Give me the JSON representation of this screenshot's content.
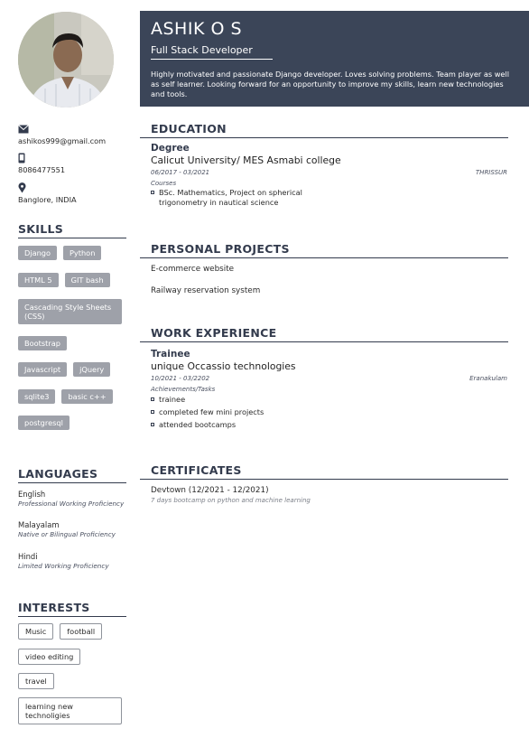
{
  "header": {
    "name": "ASHIK O S",
    "role": "Full Stack Developer",
    "summary": "Highly motivated and passionate Django developer. Loves solving problems. Team player as well as self learner. Looking forward for an opportunity to improve my skills, learn new technologies and tools."
  },
  "contact": {
    "email": "ashikos999@gmail.com",
    "phone": "8086477551",
    "location": "Banglore, INDIA",
    "icons": [
      "envelope-icon",
      "phone-icon",
      "location-pin-icon"
    ]
  },
  "skills": {
    "title": "SKILLS",
    "items": [
      "Django",
      "Python",
      "HTML 5",
      "GIT bash",
      "Cascading Style Sheets (CSS)",
      "Bootstrap",
      "Javascript",
      "jQuery",
      "sqlite3",
      "basic c++",
      "postgresql"
    ]
  },
  "languages": {
    "title": "LANGUAGES",
    "items": [
      {
        "name": "English",
        "level": "Professional Working Proficiency"
      },
      {
        "name": "Malayalam",
        "level": "Native or Bilingual Proficiency"
      },
      {
        "name": "Hindi",
        "level": "Limited Working Proficiency"
      }
    ]
  },
  "interests": {
    "title": "INTERESTS",
    "items": [
      "Music",
      "football",
      "video editing",
      "travel",
      "learning new technoligies"
    ]
  },
  "education": {
    "title": "EDUCATION",
    "degree": "Degree",
    "org": "Calicut University/ MES Asmabi college",
    "dates": "06/2017 - 03/2021",
    "place": "THRISSUR",
    "label": "Courses",
    "courses": [
      "BSc. Mathematics, Project on spherical trigonometry in nautical science"
    ]
  },
  "projects": {
    "title": "PERSONAL PROJECTS",
    "items": [
      "E-commerce website",
      "Railway reservation system"
    ]
  },
  "work": {
    "title": "WORK EXPERIENCE",
    "position": "Trainee",
    "company": "unique Occassio technologies",
    "dates": "10/2021 - 03/2202",
    "place": "Eranakulam",
    "label": "Achievements/Tasks",
    "tasks": [
      "trainee",
      "completed few mini projects",
      "attended bootcamps"
    ]
  },
  "certificates": {
    "title": "CERTIFICATES",
    "name": "Devtown (12/2021 - 12/2021)",
    "desc": "7 days bootcamp on python and machine learning"
  },
  "colors": {
    "header_bg": "#3b4558",
    "accent": "#333b4d",
    "chip_bg": "#9ea1a9"
  }
}
